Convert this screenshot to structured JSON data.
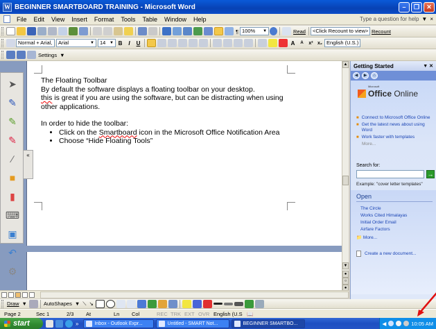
{
  "window": {
    "title": "BEGINNER SMARTBOARD TRAINING - Microsoft Word",
    "app_icon": "W"
  },
  "menu": {
    "items": [
      "File",
      "Edit",
      "View",
      "Insert",
      "Format",
      "Tools",
      "Table",
      "Window",
      "Help"
    ],
    "ask_placeholder": "Type a question for help",
    "close_glyph": "×"
  },
  "toolbar_standard": {
    "zoom": "100%",
    "read_label": "Read",
    "recount": "<Click Recount to view>",
    "recount_btn": "Recount"
  },
  "toolbar_formatting": {
    "style": "Normal + Arial,",
    "font": "Arial",
    "size": "14",
    "bold": "B",
    "italic": "I",
    "underline": "U",
    "language": "English (U.S.)"
  },
  "toolbar_smart": {
    "settings": "Settings"
  },
  "document": {
    "heading": "The Floating Toolbar",
    "para1_a": "By default the software displays a floating toolbar on your desktop.",
    "para1_b": "this",
    "para1_c": " is great if you are using the software, but can be distracting when using other applications.",
    "para2": "In order to hide the toolbar:",
    "bullet1_a": "Click on the ",
    "bullet1_b": "Smartboard",
    "bullet1_c": " icon in the Microsoft Office Notification Area",
    "bullet2": "Choose “Hide Floating Tools”"
  },
  "floating_toolbar": {
    "tab_glyph": "«"
  },
  "task_pane": {
    "title": "Getting Started",
    "logo_small": "Microsoft",
    "logo_a": "Office",
    "logo_b": " Online",
    "links": [
      "Connect to Microsoft Office Online",
      "Get the latest news about using Word",
      "Work faster with templates"
    ],
    "more1": "More...",
    "search_label": "Search for:",
    "search_go": "→",
    "example": "Example: \"cover letter templates\"",
    "open_title": "Open",
    "open_files": [
      "The Circle",
      "Works Cited Himalayas",
      "Initial Order Email",
      "Airfare Factors"
    ],
    "open_more": "More...",
    "create_new": "Create a new document..."
  },
  "drawing_toolbar": {
    "draw": "Draw",
    "autoshapes": "AutoShapes"
  },
  "status": {
    "page": "Page 2",
    "sec": "Sec 1",
    "pos": "2/3",
    "at": "At",
    "ln": "Ln",
    "col": "Col",
    "rec": "REC",
    "trk": "TRK",
    "ext": "EXT",
    "ovr": "OVR",
    "lang": "English (U.S"
  },
  "taskbar": {
    "start": "start",
    "tasks": [
      "Inbox - Outlook Expr...",
      "Untitled - SMART Not...",
      "BEGINNER SMARTBO..."
    ],
    "clock": "10:05 AM"
  },
  "colors": {
    "accent": "#0a4cc8",
    "annotation_arrow": "#e01010"
  }
}
